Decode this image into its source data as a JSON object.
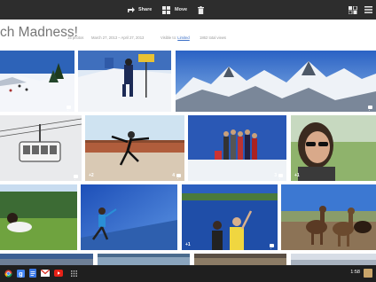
{
  "toolbar": {
    "share_label": "Share",
    "move_label": "Move"
  },
  "album": {
    "title": "ch Madness!",
    "photo_count": "15 photos",
    "date_range": "March 27, 2013 – April 27, 2013",
    "visibility_prefix": "Visible to:",
    "visibility_value": "Limited",
    "views": "1862 total views"
  },
  "photos": [
    {
      "id": "ski-slope",
      "badge": ""
    },
    {
      "id": "skier-sign",
      "badge": ""
    },
    {
      "id": "mountain-panorama",
      "badge": ""
    },
    {
      "id": "gondola",
      "badge": ""
    },
    {
      "id": "deck-jump",
      "badge": "+2"
    },
    {
      "id": "group-snow",
      "badge": ""
    },
    {
      "id": "woman-sunglasses",
      "badge": "+1"
    },
    {
      "id": "grass-lying",
      "badge": ""
    },
    {
      "id": "jump-blue-sky",
      "badge": ""
    },
    {
      "id": "lake-couple",
      "badge": "+1"
    },
    {
      "id": "alpacas",
      "badge": ""
    }
  ],
  "shelf": {
    "apps": [
      "chrome-icon",
      "google-search-icon",
      "docs-icon",
      "gmail-icon",
      "youtube-icon",
      "apps-grid-icon"
    ],
    "time": "1:58"
  },
  "colors": {
    "toolbar_bg": "#2d2d2d",
    "shelf_bg": "#1f1f1f",
    "link": "#3b6fc7"
  }
}
